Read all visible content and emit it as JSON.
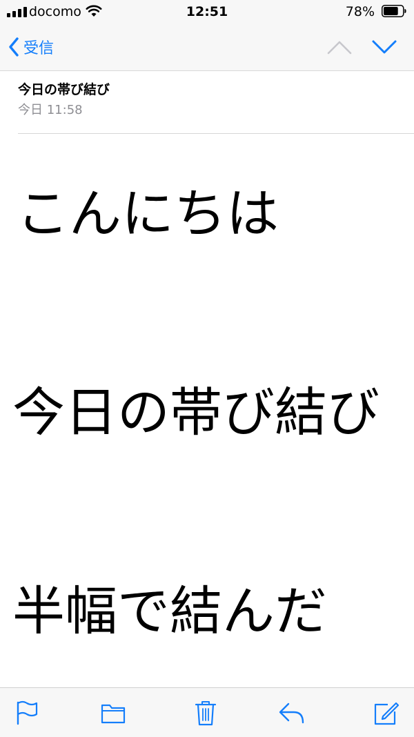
{
  "status_bar": {
    "carrier": "docomo",
    "time": "12:51",
    "battery_percent": "78%",
    "battery_level": 0.78,
    "signal_icon": "signal-bars-icon",
    "wifi_icon": "wifi-icon"
  },
  "nav": {
    "back_label": "受信",
    "back_icon": "chevron-left-icon",
    "prev_icon": "chevron-up-icon",
    "next_icon": "chevron-down-icon",
    "accent_color": "#147efb",
    "disabled_color": "#c7c7cc"
  },
  "message": {
    "subject": "今日の帯び結び",
    "date": "今日 11:58",
    "body_lines": [
      "こんにちは",
      "今日の帯び結び",
      "半幅で結んだ"
    ]
  },
  "toolbar": {
    "items": [
      "flag-icon",
      "folder-icon",
      "trash-icon",
      "reply-icon",
      "compose-icon"
    ]
  }
}
